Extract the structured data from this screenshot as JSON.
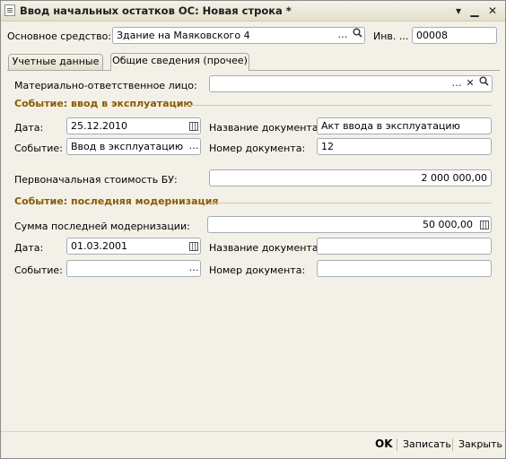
{
  "window": {
    "title": "Ввод начальных остатков ОС: Новая строка *"
  },
  "header": {
    "asset_label": "Основное средство:",
    "asset_value": "Здание на Маяковского 4",
    "inv_label": "Инв. ...",
    "inv_value": "00008"
  },
  "tabs": [
    {
      "label": "Учетные данные"
    },
    {
      "label": "Общие сведения (прочее)"
    }
  ],
  "general": {
    "responsible_label": "Материально-ответственное лицо:",
    "responsible_value": ""
  },
  "commission": {
    "section_title": "Событие: ввод в эксплуатацию",
    "date_label": "Дата:",
    "date_value": "25.12.2010",
    "event_label": "Событие:",
    "event_value": "Ввод в эксплуатацию",
    "docname_label": "Название документа:",
    "docname_value": "Акт ввода в эксплуатацию",
    "docnum_label": "Номер документа:",
    "docnum_value": "12",
    "cost_label": "Первоначальная стоимость БУ:",
    "cost_value": "2 000 000,00"
  },
  "modernization": {
    "section_title": "Событие: последняя модернизация",
    "sum_label": "Сумма последней модернизации:",
    "sum_value": "50 000,00",
    "date_label": "Дата:",
    "date_value": "01.03.2001",
    "event_label": "Событие:",
    "event_value": "",
    "docname_label": "Название документа:",
    "docname_value": "",
    "docnum_label": "Номер документа:",
    "docnum_value": ""
  },
  "buttons": {
    "ok": "OK",
    "save": "Записать",
    "close": "Закрыть"
  },
  "icons": {
    "select": "…",
    "search": "search-icon",
    "clear": "✕",
    "calendar": "calendar-icon",
    "calculator": "calculator-icon"
  }
}
